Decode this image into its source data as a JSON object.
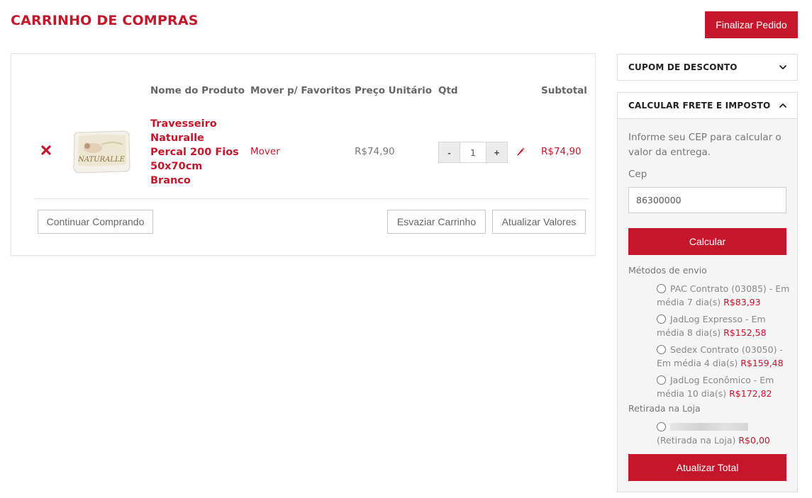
{
  "page": {
    "title": "CARRINHO DE COMPRAS",
    "finalize_label": "Finalizar Pedido"
  },
  "cart": {
    "headers": {
      "name": "Nome do Produto",
      "move": "Mover p/ Favoritos",
      "unit_price": "Preço Unitário",
      "qty": "Qtd",
      "subtotal": "Subtotal"
    },
    "item": {
      "name": "Travesseiro Naturalle Percal 200 Fios 50x70cm Branco",
      "thumb_text": "NATURALLE",
      "move_label": "Mover",
      "unit_price": "R$74,90",
      "qty": "1",
      "qty_minus": "-",
      "qty_plus": "+",
      "subtotal": "R$74,90"
    },
    "buttons": {
      "continue": "Continuar Comprando",
      "empty": "Esvaziar Carrinho",
      "update": "Atualizar Valores"
    }
  },
  "sidebar": {
    "coupon_title": "CUPOM DE DESCONTO",
    "freight_title": "CALCULAR FRETE E IMPOSTO",
    "freight_info": "Informe seu CEP para calcular o valor da entrega.",
    "cep_label": "Cep",
    "cep_value": "86300000",
    "calc_label": "Calcular",
    "methods_label": "Métodos de envio",
    "methods": [
      {
        "text": "PAC Contrato (03085) - Em média 7 dia(s)",
        "price": "R$83,93"
      },
      {
        "text": "JadLog Expresso - Em média 8 dia(s)",
        "price": "R$152,58"
      },
      {
        "text": "Sedex Contrato (03050) - Em média 4 dia(s)",
        "price": "R$159,48"
      },
      {
        "text": "JadLog Econômico - Em média 10 dia(s)",
        "price": "R$172,82"
      }
    ],
    "pickup_label": "Retirada na Loja",
    "pickup": {
      "text": "(Retirada na Loja)",
      "price": "R$0,00"
    },
    "update_total_label": "Atualizar Total"
  },
  "colors": {
    "brand": "#c4172c",
    "text": "#555555",
    "panel_bg": "#f5f5f5"
  }
}
